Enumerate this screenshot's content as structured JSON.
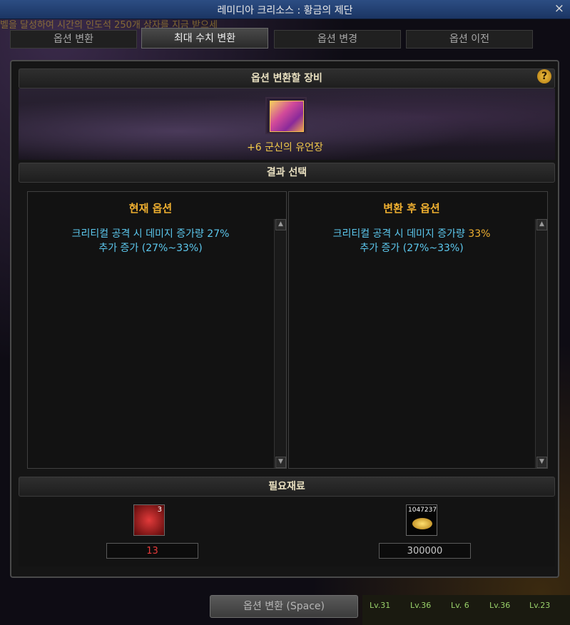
{
  "window": {
    "title": "레미디아 크리소스 : 황금의 제단",
    "close_glyph": "×",
    "background_text": "벨을 달성하여 시간의 인도석 250개 상자를 지금 받으세"
  },
  "tabs": [
    {
      "label": "옵션 변환",
      "active": false
    },
    {
      "label": "최대 수치 변환",
      "active": true
    },
    {
      "label": "옵션 변경",
      "active": false
    },
    {
      "label": "옵션 이전",
      "active": false
    }
  ],
  "equipment": {
    "header": "옵션 변환할 장비",
    "help": "?",
    "item_name": "+6 군신의 유언장",
    "icon": "staff-item-icon"
  },
  "result": {
    "header": "결과 선택",
    "current": {
      "title": "현재 옵션",
      "line1": "크리티컬 공격 시 데미지 증가량 27%",
      "line2": "추가 증가 (27%~33%)"
    },
    "after": {
      "title": "변환 후 옵션",
      "line1_prefix": "크리티컬 공격 시 데미지 증가량 ",
      "line1_value": "33%",
      "line2": "추가 증가 (27%~33%)"
    }
  },
  "materials": {
    "header": "필요재료",
    "items": [
      {
        "icon": "red-crystal-icon",
        "stack": "3",
        "required": "13"
      },
      {
        "icon": "gold-coins-icon",
        "stack": "1047237",
        "required": "300000"
      }
    ]
  },
  "actions": {
    "convert_label": "옵션 변환 (Space)"
  },
  "skillbar": {
    "locks": [
      "Lv.31",
      "Lv.36",
      "Lv. 6",
      "Lv.36",
      "Lv.23"
    ]
  },
  "colors": {
    "accent_gold": "#f0b030",
    "option_blue": "#5cc8ee",
    "material_red": "#e83a3a",
    "title_bar": "#2c4d83"
  }
}
